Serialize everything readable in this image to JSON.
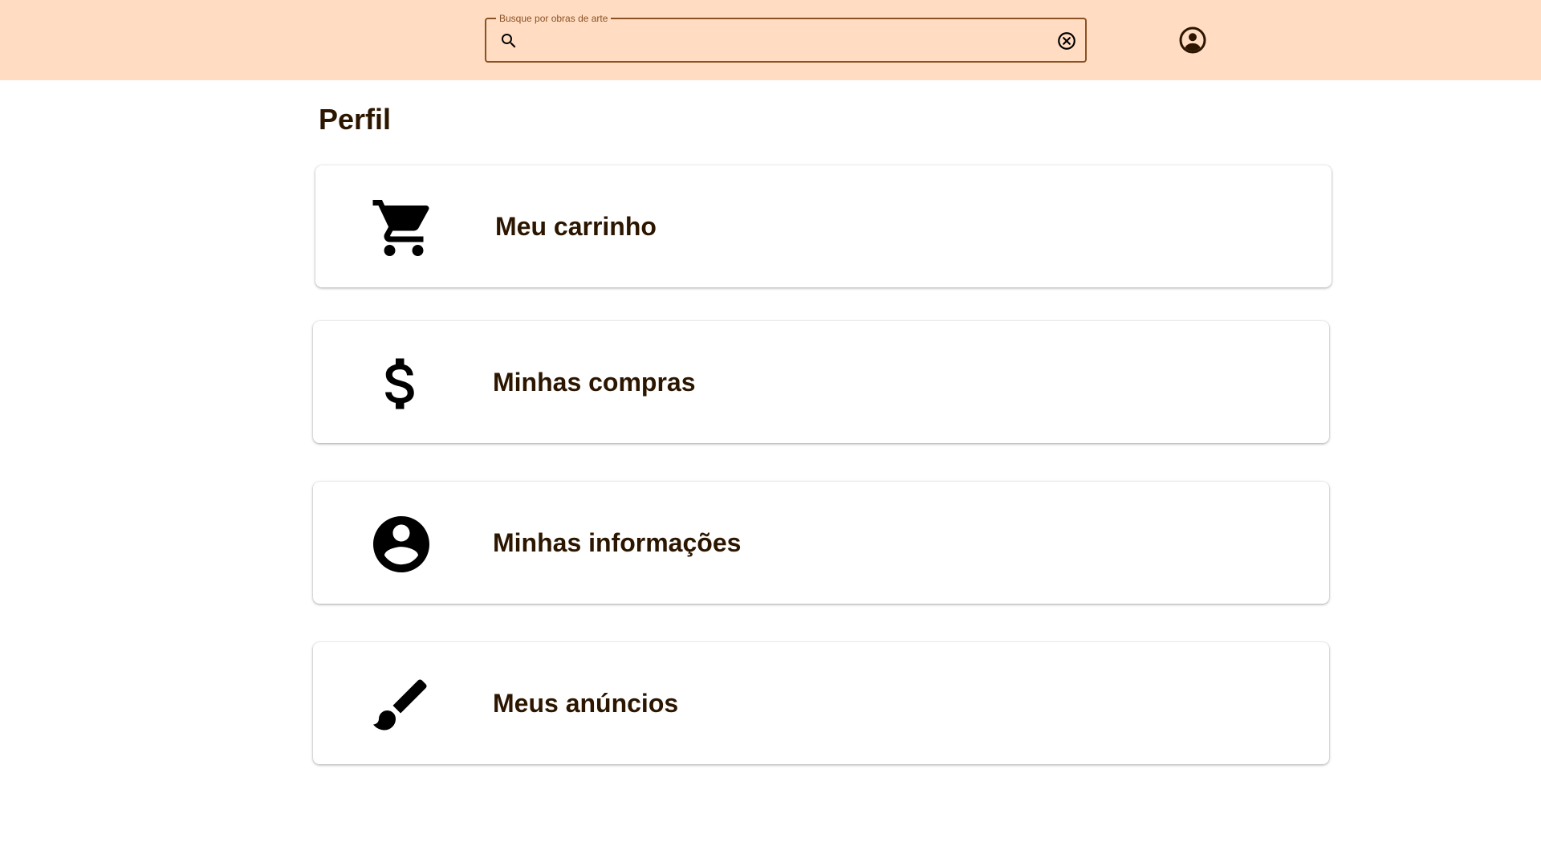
{
  "header": {
    "search": {
      "label": "Busque por obras de arte",
      "value": "",
      "placeholder": ""
    },
    "icons": {
      "search": "search-icon",
      "clear": "cancel-circle-icon",
      "account": "account-circle-icon"
    }
  },
  "page": {
    "title": "Perfil"
  },
  "menu": {
    "cart": {
      "label": "Meu carrinho",
      "icon": "shopping-cart-icon"
    },
    "purchases": {
      "label": "Minhas compras",
      "icon": "dollar-icon"
    },
    "info": {
      "label": "Minhas informações",
      "icon": "account-circle-icon"
    },
    "ads": {
      "label": "Meus anúncios",
      "icon": "paintbrush-icon"
    }
  },
  "colors": {
    "header_bg": "#ffdcc2",
    "accent": "#8a5224",
    "text": "#2c1600",
    "icon": "#000000"
  }
}
